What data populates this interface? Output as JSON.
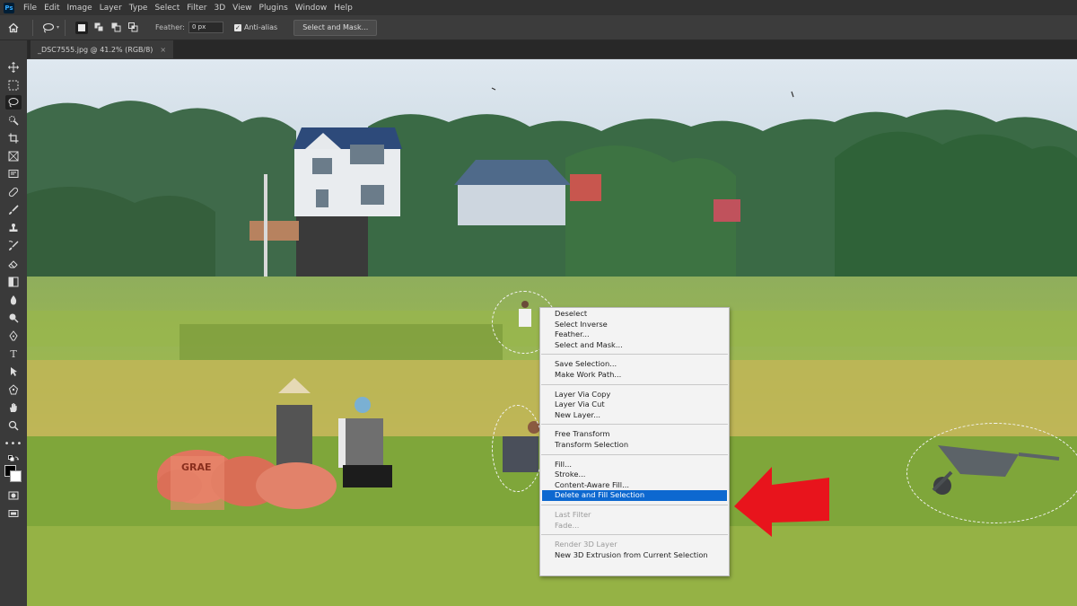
{
  "app": {
    "logo": "Ps"
  },
  "menu": [
    "File",
    "Edit",
    "Image",
    "Layer",
    "Type",
    "Select",
    "Filter",
    "3D",
    "View",
    "Plugins",
    "Window",
    "Help"
  ],
  "options": {
    "feather_label": "Feather:",
    "feather_value": "0 px",
    "antialias_label": "Anti-alias",
    "antialias_checked": true,
    "select_mask_label": "Select and Mask..."
  },
  "document": {
    "tab_title": "_DSC7555.jpg @ 41.2% (RGB/8)"
  },
  "toolbar_tools": [
    "move-icon",
    "marquee-icon",
    "lasso-icon",
    "quick-selection-icon",
    "crop-icon",
    "frame-icon",
    "eyedropper-icon",
    "healing-brush-icon",
    "brush-icon",
    "clone-stamp-icon",
    "history-brush-icon",
    "eraser-icon",
    "gradient-icon",
    "blur-icon",
    "dodge-icon",
    "pen-icon",
    "type-icon",
    "path-selection-icon",
    "rectangle-icon",
    "hand-icon",
    "zoom-icon",
    "more-tools-icon",
    "color-swatches-icon",
    "quick-mask-icon",
    "screen-mode-icon"
  ],
  "colors": {
    "foreground": "#000000",
    "background": "#ffffff",
    "highlight": "#0d68d0",
    "arrow": "#e8141c"
  },
  "context_menu": [
    {
      "label": "Deselect",
      "state": "normal"
    },
    {
      "label": "Select Inverse",
      "state": "normal"
    },
    {
      "label": "Feather...",
      "state": "normal"
    },
    {
      "label": "Select and Mask...",
      "state": "normal"
    },
    {
      "sep": true
    },
    {
      "label": "Save Selection...",
      "state": "normal"
    },
    {
      "label": "Make Work Path...",
      "state": "normal"
    },
    {
      "sep": true
    },
    {
      "label": "Layer Via Copy",
      "state": "normal"
    },
    {
      "label": "Layer Via Cut",
      "state": "normal"
    },
    {
      "label": "New Layer...",
      "state": "normal"
    },
    {
      "sep": true
    },
    {
      "label": "Free Transform",
      "state": "normal"
    },
    {
      "label": "Transform Selection",
      "state": "normal"
    },
    {
      "sep": true
    },
    {
      "label": "Fill...",
      "state": "normal"
    },
    {
      "label": "Stroke...",
      "state": "normal"
    },
    {
      "label": "Content-Aware Fill...",
      "state": "normal"
    },
    {
      "label": "Delete and Fill Selection",
      "state": "highlighted"
    },
    {
      "sep": true
    },
    {
      "label": "Last Filter",
      "state": "disabled"
    },
    {
      "label": "Fade...",
      "state": "disabled"
    },
    {
      "sep": true
    },
    {
      "label": "Render 3D Layer",
      "state": "disabled"
    },
    {
      "label": "New 3D Extrusion from Current Selection",
      "state": "normal"
    }
  ],
  "sack_text": "GRAE"
}
